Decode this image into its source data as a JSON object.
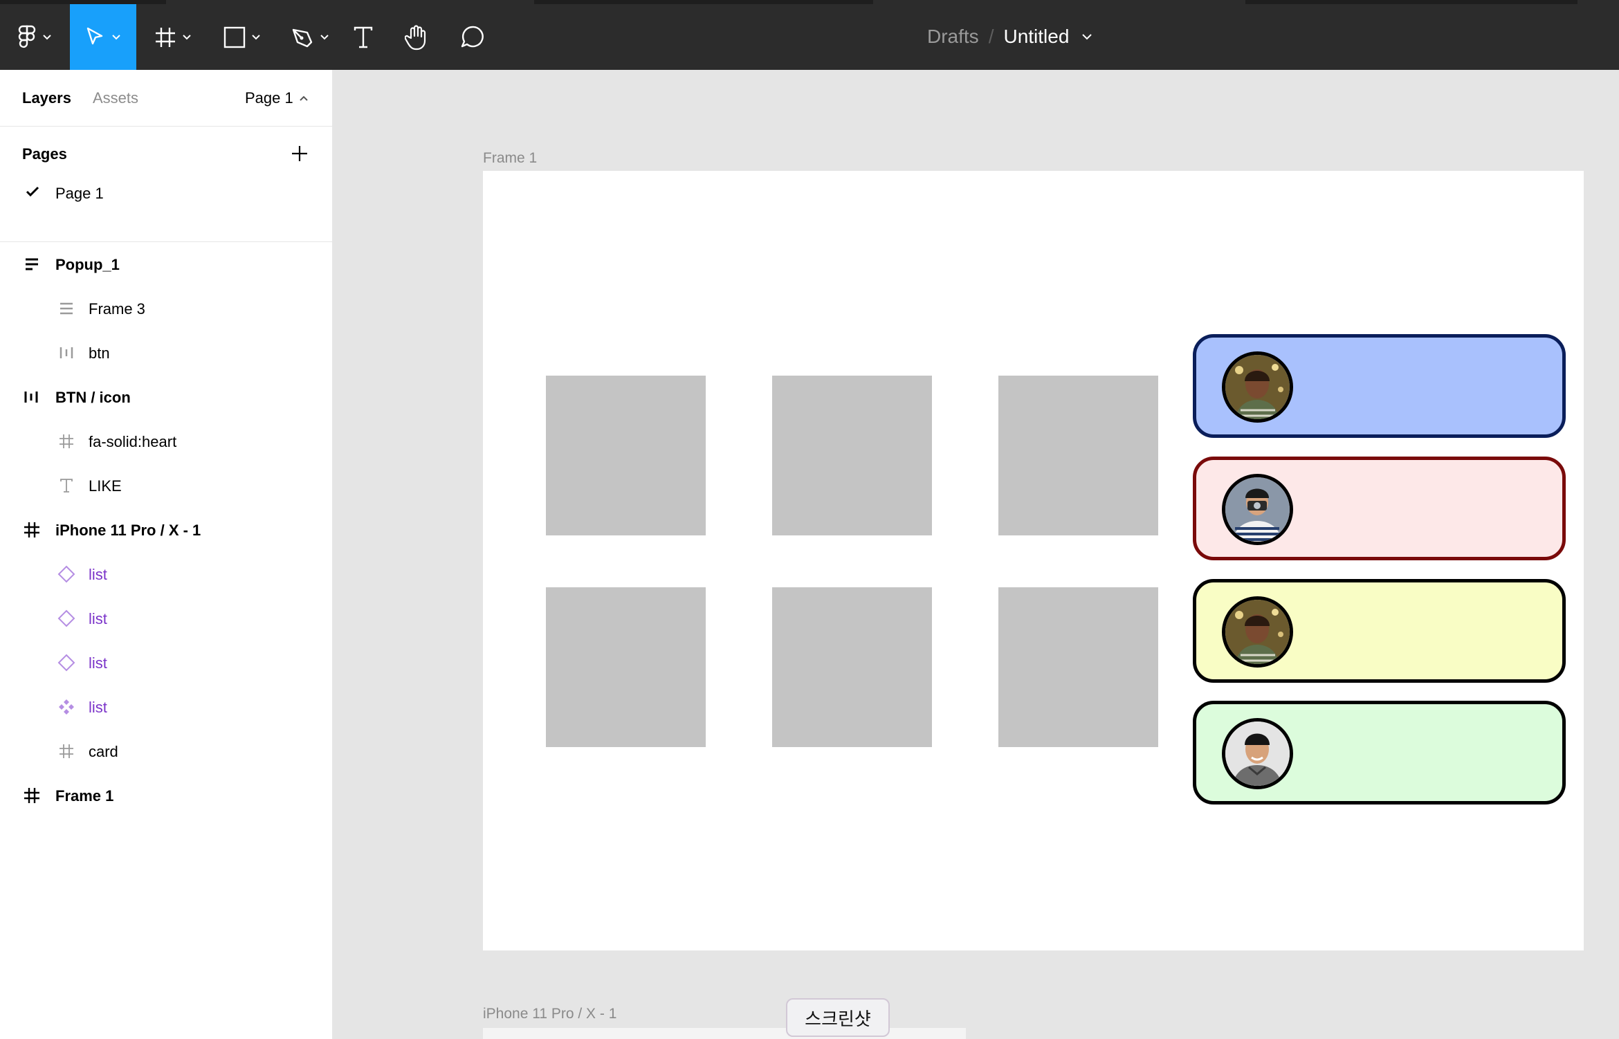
{
  "breadcrumb": {
    "folder": "Drafts",
    "separator": "/",
    "file": "Untitled"
  },
  "panel_tabs": {
    "layers": "Layers",
    "assets": "Assets",
    "page_switch": "Page 1"
  },
  "pages": {
    "title": "Pages",
    "items": [
      "Page 1"
    ]
  },
  "layers": [
    {
      "label": "Popup_1",
      "icon": "auto-layout-vertical-icon"
    },
    {
      "label": "Frame 3",
      "icon": "auto-layout-vertical-icon"
    },
    {
      "label": "btn",
      "icon": "auto-layout-horizontal-icon"
    },
    {
      "label": "BTN / icon",
      "icon": "auto-layout-horizontal-icon"
    },
    {
      "label": "fa-solid:heart",
      "icon": "frame-icon"
    },
    {
      "label": "LIKE",
      "icon": "text-icon"
    },
    {
      "label": "iPhone 11 Pro / X - 1",
      "icon": "frame-icon"
    },
    {
      "label": "list",
      "icon": "instance-icon"
    },
    {
      "label": "list",
      "icon": "instance-icon"
    },
    {
      "label": "list",
      "icon": "instance-icon"
    },
    {
      "label": "list",
      "icon": "component-icon"
    },
    {
      "label": "card",
      "icon": "frame-icon"
    },
    {
      "label": "Frame 1",
      "icon": "frame-icon"
    }
  ],
  "canvas": {
    "frame1_label": "Frame 1",
    "frame2_label": "iPhone 11 Pro / X - 1",
    "cards": [
      {
        "fill": "#a9c1fd",
        "border": "#0a1e5a"
      },
      {
        "fill": "#fde8e8",
        "border": "#7a0a0a"
      },
      {
        "fill": "#f9fdc5",
        "border": "#000000"
      },
      {
        "fill": "#dcfcdc",
        "border": "#000000"
      }
    ]
  },
  "tooltip": "스크린샷",
  "colors": {
    "accent": "#18a0fb",
    "toolbar": "#2c2c2c",
    "component": "#7b34c9"
  }
}
